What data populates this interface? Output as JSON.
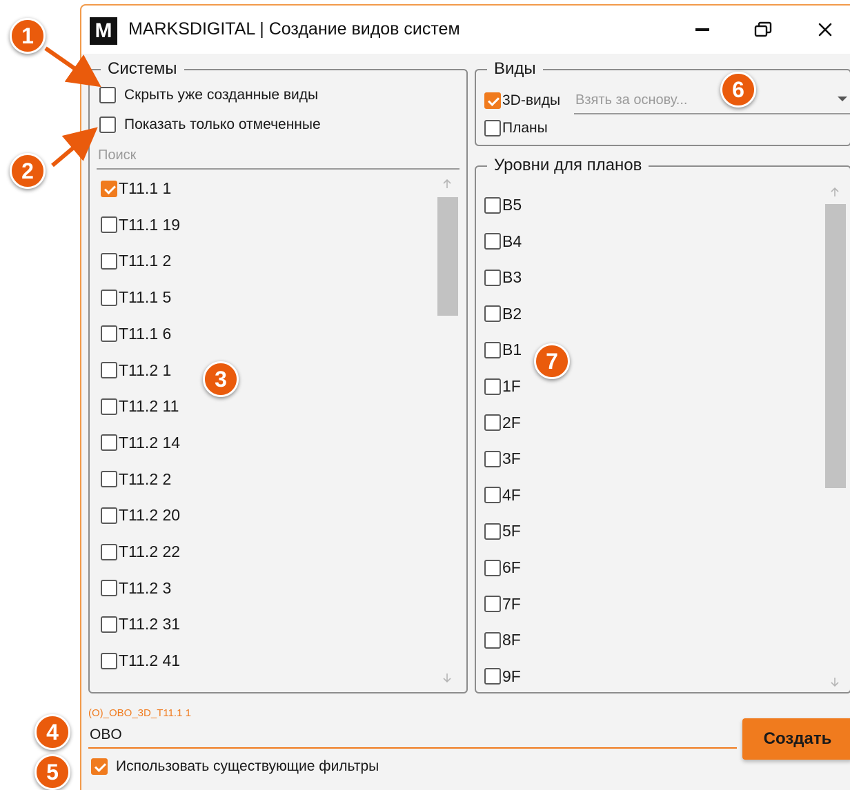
{
  "window": {
    "logo_letter": "M",
    "title": "MARKSDIGITAL | Создание видов систем"
  },
  "systems": {
    "legend": "Системы",
    "hide_created": {
      "label": "Скрыть уже созданные виды",
      "checked": false
    },
    "show_checked_only": {
      "label": "Показать только отмеченные",
      "checked": false
    },
    "search_placeholder": "Поиск",
    "items": [
      {
        "label": "T11.1 1",
        "checked": true
      },
      {
        "label": "T11.1 19",
        "checked": false
      },
      {
        "label": "T11.1 2",
        "checked": false
      },
      {
        "label": "T11.1 5",
        "checked": false
      },
      {
        "label": "T11.1 6",
        "checked": false
      },
      {
        "label": "T11.2 1",
        "checked": false
      },
      {
        "label": "T11.2 11",
        "checked": false
      },
      {
        "label": "T11.2 14",
        "checked": false
      },
      {
        "label": "T11.2 2",
        "checked": false
      },
      {
        "label": "T11.2 20",
        "checked": false
      },
      {
        "label": "T11.2 22",
        "checked": false
      },
      {
        "label": "T11.2 3",
        "checked": false
      },
      {
        "label": "T11.2 31",
        "checked": false
      },
      {
        "label": "T11.2 41",
        "checked": false
      }
    ]
  },
  "views": {
    "legend": "Виды",
    "views_3d": {
      "label": "3D-виды",
      "checked": true
    },
    "plans": {
      "label": "Планы",
      "checked": false
    },
    "base_placeholder": "Взять за основу..."
  },
  "levels": {
    "legend": "Уровни для планов",
    "items": [
      {
        "label": "B5",
        "checked": false
      },
      {
        "label": "B4",
        "checked": false
      },
      {
        "label": "B3",
        "checked": false
      },
      {
        "label": "B2",
        "checked": false
      },
      {
        "label": "B1",
        "checked": false
      },
      {
        "label": "1F",
        "checked": false
      },
      {
        "label": "2F",
        "checked": false
      },
      {
        "label": "3F",
        "checked": false
      },
      {
        "label": "4F",
        "checked": false
      },
      {
        "label": "5F",
        "checked": false
      },
      {
        "label": "6F",
        "checked": false
      },
      {
        "label": "7F",
        "checked": false
      },
      {
        "label": "8F",
        "checked": false
      },
      {
        "label": "9F",
        "checked": false
      }
    ]
  },
  "bottom": {
    "name_hint": "(O)_OBO_3D_T11.1 1",
    "name_value": "OBO",
    "use_filters": {
      "label": "Использовать существующие фильтры",
      "checked": true
    },
    "create_label": "Создать"
  },
  "callouts": [
    "1",
    "2",
    "3",
    "4",
    "5",
    "6",
    "7"
  ],
  "colors": {
    "accent": "#f07b1e",
    "callout": "#ea5b0c"
  }
}
